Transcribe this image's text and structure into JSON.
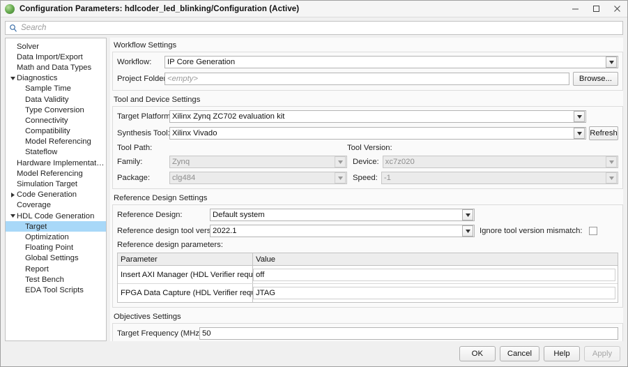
{
  "window": {
    "title": "Configuration Parameters: hdlcoder_led_blinking/Configuration (Active)",
    "app_icon": "simulink-icon",
    "controls": {
      "minimize": "minimize-icon",
      "maximize": "maximize-icon",
      "close": "close-icon"
    }
  },
  "search": {
    "icon": "search-icon",
    "value": "",
    "placeholder": "Search"
  },
  "tree": {
    "items": [
      {
        "label": "Solver",
        "level": 1,
        "twisty": "none",
        "selected": false
      },
      {
        "label": "Data Import/Export",
        "level": 1,
        "twisty": "none",
        "selected": false
      },
      {
        "label": "Math and Data Types",
        "level": 1,
        "twisty": "none",
        "selected": false
      },
      {
        "label": "Diagnostics",
        "level": 1,
        "twisty": "expanded",
        "selected": false
      },
      {
        "label": "Sample Time",
        "level": 2,
        "twisty": "none",
        "selected": false
      },
      {
        "label": "Data Validity",
        "level": 2,
        "twisty": "none",
        "selected": false
      },
      {
        "label": "Type Conversion",
        "level": 2,
        "twisty": "none",
        "selected": false
      },
      {
        "label": "Connectivity",
        "level": 2,
        "twisty": "none",
        "selected": false
      },
      {
        "label": "Compatibility",
        "level": 2,
        "twisty": "none",
        "selected": false
      },
      {
        "label": "Model Referencing",
        "level": 2,
        "twisty": "none",
        "selected": false
      },
      {
        "label": "Stateflow",
        "level": 2,
        "twisty": "none",
        "selected": false
      },
      {
        "label": "Hardware Implementation",
        "level": 1,
        "twisty": "none",
        "selected": false
      },
      {
        "label": "Model Referencing",
        "level": 1,
        "twisty": "none",
        "selected": false
      },
      {
        "label": "Simulation Target",
        "level": 1,
        "twisty": "none",
        "selected": false
      },
      {
        "label": "Code Generation",
        "level": 1,
        "twisty": "collapsed",
        "selected": false
      },
      {
        "label": "Coverage",
        "level": 1,
        "twisty": "none",
        "selected": false
      },
      {
        "label": "HDL Code Generation",
        "level": 1,
        "twisty": "expanded",
        "selected": false
      },
      {
        "label": "Target",
        "level": 2,
        "twisty": "none",
        "selected": true
      },
      {
        "label": "Optimization",
        "level": 2,
        "twisty": "none",
        "selected": false
      },
      {
        "label": "Floating Point",
        "level": 2,
        "twisty": "none",
        "selected": false
      },
      {
        "label": "Global Settings",
        "level": 2,
        "twisty": "none",
        "selected": false
      },
      {
        "label": "Report",
        "level": 2,
        "twisty": "none",
        "selected": false
      },
      {
        "label": "Test Bench",
        "level": 2,
        "twisty": "none",
        "selected": false
      },
      {
        "label": "EDA Tool Scripts",
        "level": 2,
        "twisty": "none",
        "selected": false
      }
    ],
    "selection_color": "#a8d8f8"
  },
  "workflow_settings": {
    "title": "Workflow Settings",
    "workflow_label": "Workflow:",
    "workflow_value": "IP Core Generation",
    "project_folder_label": "Project Folder:",
    "project_folder_value": "<empty>",
    "browse_label": "Browse..."
  },
  "tool_device_settings": {
    "title": "Tool and Device Settings",
    "target_platform_label": "Target Platform:",
    "target_platform_value": "Xilinx Zynq ZC702 evaluation kit",
    "synthesis_tool_label": "Synthesis Tool:",
    "synthesis_tool_value": "Xilinx Vivado",
    "refresh_label": "Refresh",
    "tool_path_label": "Tool Path:",
    "tool_version_label": "Tool Version:",
    "family_label": "Family:",
    "family_value": "Zynq",
    "device_label": "Device:",
    "device_value": "xc7z020",
    "package_label": "Package:",
    "package_value": "clg484",
    "speed_label": "Speed:",
    "speed_value": "-1"
  },
  "reference_design_settings": {
    "title": "Reference Design Settings",
    "reference_design_label": "Reference Design:",
    "reference_design_value": "Default system",
    "tool_version_label": "Reference design tool version:",
    "tool_version_value": "2022.1",
    "ignore_mismatch_label": "Ignore tool version mismatch:",
    "ignore_mismatch_checked": false,
    "parameters_label": "Reference design parameters:",
    "table": {
      "columns": [
        "Parameter",
        "Value"
      ],
      "rows": [
        {
          "parameter": "Insert AXI Manager (HDL Verifier required)",
          "value": "off"
        },
        {
          "parameter": "FPGA Data Capture (HDL Verifier required)",
          "value": "JTAG"
        }
      ]
    }
  },
  "objectives_settings": {
    "title": "Objectives Settings",
    "target_frequency_label": "Target Frequency (MHz):",
    "target_frequency_value": "50"
  },
  "footer": {
    "ok_label": "OK",
    "cancel_label": "Cancel",
    "help_label": "Help",
    "apply_label": "Apply",
    "apply_enabled": false
  }
}
